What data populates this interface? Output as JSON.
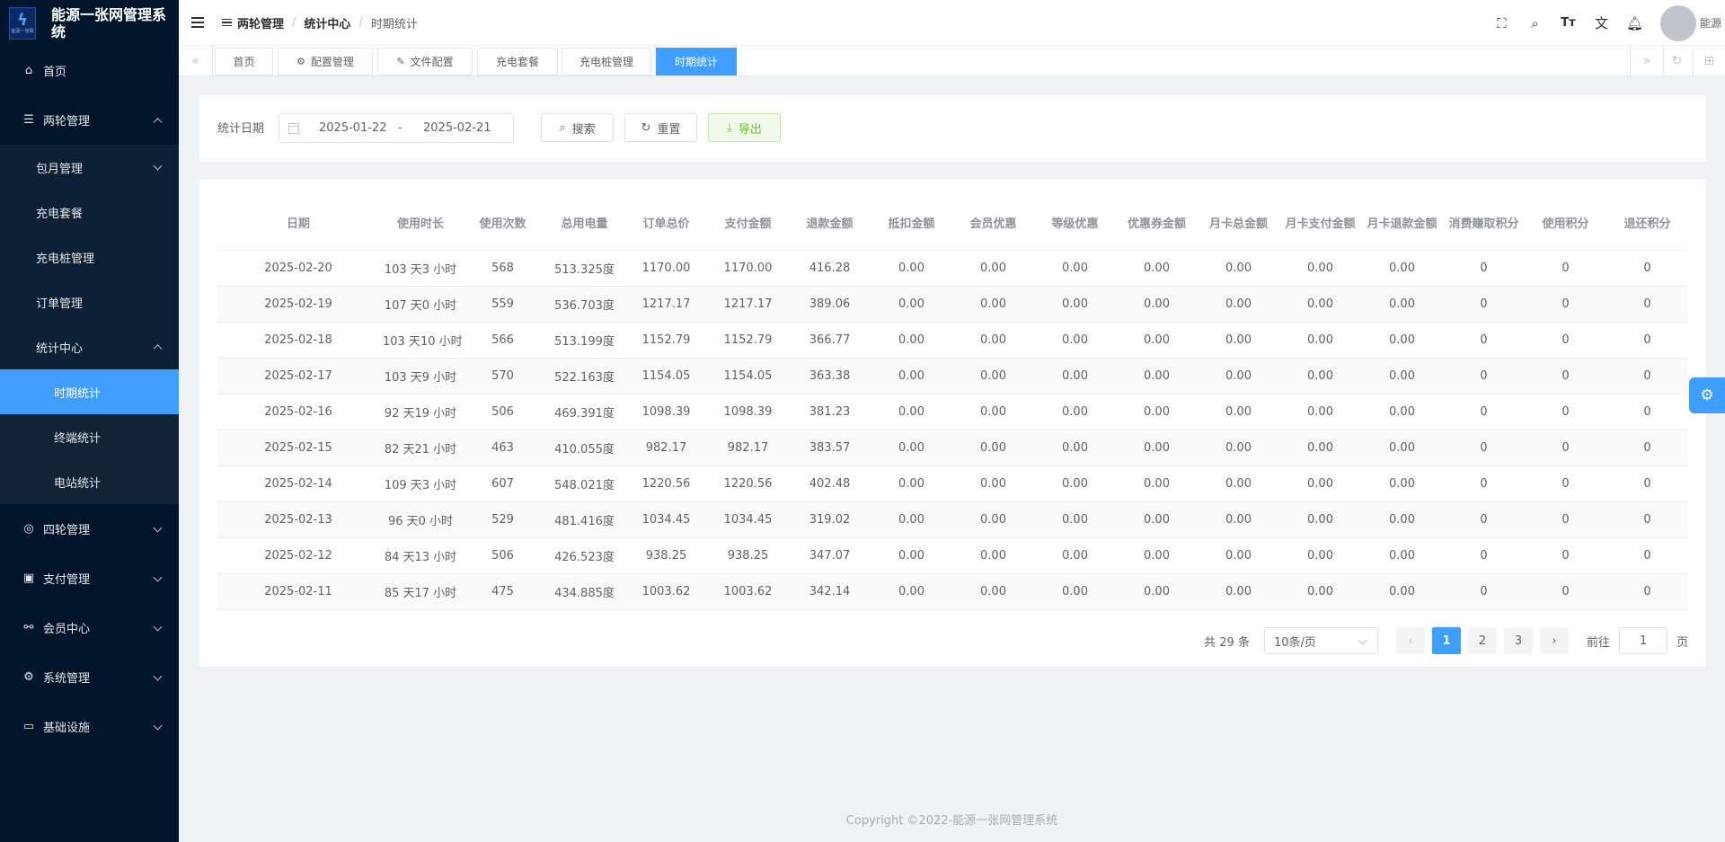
{
  "app": {
    "title": "能源一张网管理系统",
    "logo_small": "能源一张网"
  },
  "sidebar": {
    "home": "首页",
    "two_wheel": "两轮管理",
    "two_wheel_items": {
      "monthly": "包月管理",
      "package": "充电套餐",
      "pile": "充电桩管理",
      "order": "订单管理",
      "stats": "统计中心"
    },
    "stats_items": {
      "period": "时期统计",
      "terminal": "终端统计",
      "station": "电站统计"
    },
    "four_wheel": "四轮管理",
    "payment": "支付管理",
    "member": "会员中心",
    "system": "系统管理",
    "infra": "基础设施"
  },
  "header": {
    "breadcrumb": [
      "两轮管理",
      "统计中心",
      "时期统计"
    ],
    "username": "能源",
    "icons": [
      "fullscreen-icon",
      "search-icon",
      "font-size-icon",
      "translate-icon",
      "bell-icon"
    ]
  },
  "tags": [
    "首页",
    "配置管理",
    "文件配置",
    "充电套餐",
    "充电桩管理",
    "时期统计"
  ],
  "search": {
    "label": "统计日期",
    "start_date": "2025-01-22",
    "separator": "-",
    "end_date": "2025-02-21",
    "search_btn": "搜索",
    "reset_btn": "重置",
    "export_btn": "导出"
  },
  "table": {
    "columns": [
      "日期",
      "使用时长",
      "使用次数",
      "总用电量",
      "订单总价",
      "支付金额",
      "退款金额",
      "抵扣金额",
      "会员优惠",
      "等级优惠",
      "优惠券金额",
      "月卡总金额",
      "月卡支付金额",
      "月卡退款金额",
      "消费赚取积分",
      "使用积分",
      "退还积分"
    ],
    "rows": [
      [
        "2025-02-20",
        "103 天3 小时",
        "568",
        "513.325度",
        "1170.00",
        "1170.00",
        "416.28",
        "0.00",
        "0.00",
        "0.00",
        "0.00",
        "0.00",
        "0.00",
        "0.00",
        "0",
        "0",
        "0"
      ],
      [
        "2025-02-19",
        "107 天0 小时",
        "559",
        "536.703度",
        "1217.17",
        "1217.17",
        "389.06",
        "0.00",
        "0.00",
        "0.00",
        "0.00",
        "0.00",
        "0.00",
        "0.00",
        "0",
        "0",
        "0"
      ],
      [
        "2025-02-18",
        "103 天10 小时",
        "566",
        "513.199度",
        "1152.79",
        "1152.79",
        "366.77",
        "0.00",
        "0.00",
        "0.00",
        "0.00",
        "0.00",
        "0.00",
        "0.00",
        "0",
        "0",
        "0"
      ],
      [
        "2025-02-17",
        "103 天9 小时",
        "570",
        "522.163度",
        "1154.05",
        "1154.05",
        "363.38",
        "0.00",
        "0.00",
        "0.00",
        "0.00",
        "0.00",
        "0.00",
        "0.00",
        "0",
        "0",
        "0"
      ],
      [
        "2025-02-16",
        "92 天19 小时",
        "506",
        "469.391度",
        "1098.39",
        "1098.39",
        "381.23",
        "0.00",
        "0.00",
        "0.00",
        "0.00",
        "0.00",
        "0.00",
        "0.00",
        "0",
        "0",
        "0"
      ],
      [
        "2025-02-15",
        "82 天21 小时",
        "463",
        "410.055度",
        "982.17",
        "982.17",
        "383.57",
        "0.00",
        "0.00",
        "0.00",
        "0.00",
        "0.00",
        "0.00",
        "0.00",
        "0",
        "0",
        "0"
      ],
      [
        "2025-02-14",
        "109 天3 小时",
        "607",
        "548.021度",
        "1220.56",
        "1220.56",
        "402.48",
        "0.00",
        "0.00",
        "0.00",
        "0.00",
        "0.00",
        "0.00",
        "0.00",
        "0",
        "0",
        "0"
      ],
      [
        "2025-02-13",
        "96 天0 小时",
        "529",
        "481.416度",
        "1034.45",
        "1034.45",
        "319.02",
        "0.00",
        "0.00",
        "0.00",
        "0.00",
        "0.00",
        "0.00",
        "0.00",
        "0",
        "0",
        "0"
      ],
      [
        "2025-02-12",
        "84 天13 小时",
        "506",
        "426.523度",
        "938.25",
        "938.25",
        "347.07",
        "0.00",
        "0.00",
        "0.00",
        "0.00",
        "0.00",
        "0.00",
        "0.00",
        "0",
        "0",
        "0"
      ],
      [
        "2025-02-11",
        "85 天17 小时",
        "475",
        "434.885度",
        "1003.62",
        "1003.62",
        "342.14",
        "0.00",
        "0.00",
        "0.00",
        "0.00",
        "0.00",
        "0.00",
        "0.00",
        "0",
        "0",
        "0"
      ]
    ]
  },
  "pagination": {
    "total": "共 29 条",
    "page_size": "10条/页",
    "pages": [
      "1",
      "2",
      "3"
    ],
    "current": "1",
    "goto_label": "前往",
    "goto_value": "1",
    "goto_unit": "页"
  },
  "footer": "Copyright ©2022-能源一张网管理系统",
  "colors": {
    "sidebar_bg": "#001529",
    "accent": "#409eff",
    "export_green": "#67c23a"
  }
}
